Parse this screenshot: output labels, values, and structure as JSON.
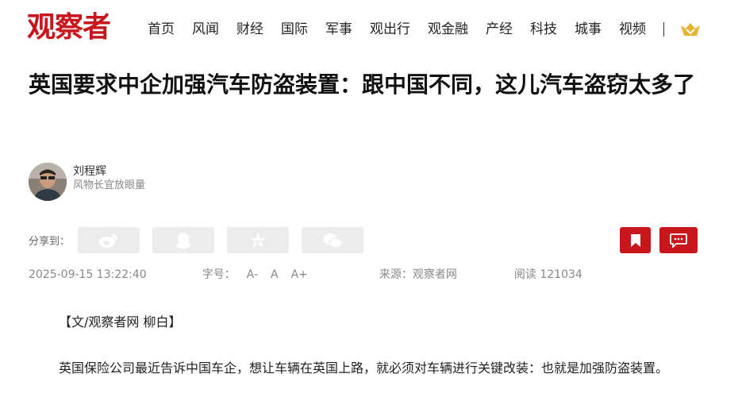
{
  "logo": {
    "text": "观察者"
  },
  "nav": {
    "items": [
      "首页",
      "风闻",
      "财经",
      "国际",
      "军事",
      "观出行",
      "观金融",
      "产经",
      "科技",
      "城事",
      "视频"
    ]
  },
  "article": {
    "title": "英国要求中企加强汽车防盗装置：跟中国不同，这儿汽车盗窃太多了",
    "author_name": "刘程辉",
    "author_desc": "风物长宜放眼量",
    "share_label": "分享到：",
    "date": "2025-09-15 13:22:40",
    "font_size_label": "字号：",
    "font_small": "A-",
    "font_normal": "A",
    "font_large": "A+",
    "source": "来源：观察者网",
    "reads": "阅读 121034",
    "paragraphs": [
      "【文/观察者网 柳白】",
      "英国保险公司最近告诉中国车企，想让车辆在英国上路，就必须对车辆进行关键改装：也就是加强防盗装置。"
    ]
  },
  "colors": {
    "brand": "#c8161d",
    "gold": "#e8b431"
  },
  "icons": [
    "weibo-icon",
    "qq-icon",
    "qzone-icon",
    "wechat-icon",
    "bookmark-icon",
    "comment-icon",
    "vip-crown-icon"
  ]
}
